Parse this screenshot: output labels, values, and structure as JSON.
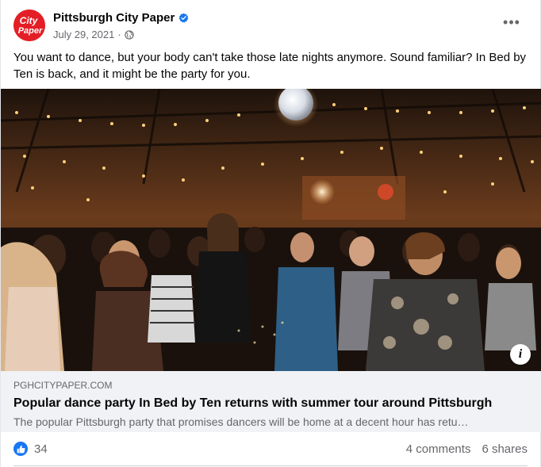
{
  "post": {
    "page_name": "Pittsburgh City Paper",
    "avatar_text_top": "City",
    "avatar_text_bottom": "Paper",
    "date": "July 29, 2021",
    "separator": "·",
    "body": "You want to dance, but your body can't take those late nights anymore. Sound familiar? In Bed by Ten is back, and it might be the party for you.",
    "more_label": "•••"
  },
  "link": {
    "domain": "PGHCITYPAPER.COM",
    "headline": "Popular dance party In Bed by Ten returns with summer tour around Pittsburgh",
    "description": "The popular Pittsburgh party that promises dancers will be home at a decent hour has retu…",
    "info_label": "i"
  },
  "stats": {
    "likes": "34",
    "comments": "4 comments",
    "shares": "6 shares"
  },
  "colors": {
    "brand_red": "#e41e26",
    "facebook_blue": "#1877f2",
    "secondary_text": "#65676b",
    "link_box_bg": "#f0f2f5"
  },
  "icons": {
    "verified": "verified-badge-icon",
    "privacy": "globe-icon",
    "more": "more-options-icon",
    "like": "thumbs-up-icon",
    "info": "info-icon"
  }
}
